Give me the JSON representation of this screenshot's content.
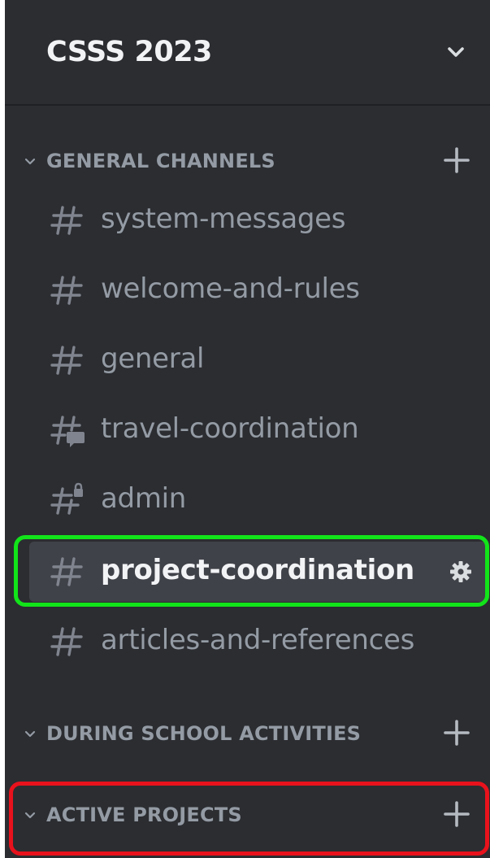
{
  "server": {
    "name": "CSSS 2023"
  },
  "categories": [
    {
      "label": "GENERAL CHANNELS",
      "channels": [
        {
          "label": "system-messages",
          "icon": "hash-icon"
        },
        {
          "label": "welcome-and-rules",
          "icon": "hash-icon"
        },
        {
          "label": "general",
          "icon": "hash-icon"
        },
        {
          "label": "travel-coordination",
          "icon": "forum-hash-icon"
        },
        {
          "label": "admin",
          "icon": "locked-hash-icon"
        },
        {
          "label": "project-coordination",
          "icon": "hash-icon",
          "selected": true
        },
        {
          "label": "articles-and-references",
          "icon": "hash-icon"
        }
      ]
    },
    {
      "label": "DURING SCHOOL ACTIVITIES",
      "channels": []
    },
    {
      "label": "ACTIVE PROJECTS",
      "channels": []
    }
  ],
  "colors": {
    "sidebar_bg": "#2b2d31",
    "selected_bg": "#404249",
    "muted_text": "#949ba4",
    "bright_text": "#f2f3f5",
    "highlight_green": "#12e41a",
    "highlight_red": "#e8121c"
  }
}
